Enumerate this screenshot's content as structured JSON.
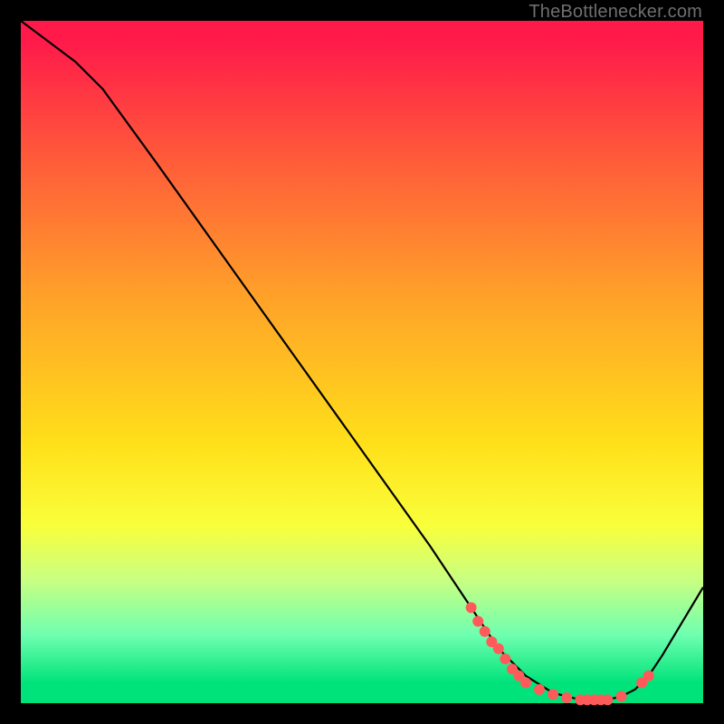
{
  "attribution": "TheBottlenecker.com",
  "chart_data": {
    "type": "line",
    "title": "",
    "xlabel": "",
    "ylabel": "",
    "xlim": [
      0,
      100
    ],
    "ylim": [
      0,
      100
    ],
    "series": [
      {
        "name": "curve",
        "x": [
          0,
          4,
          8,
          12,
          20,
          30,
          40,
          50,
          60,
          66,
          70,
          74,
          78,
          82,
          86,
          88,
          90,
          92,
          94,
          100
        ],
        "y": [
          100,
          97,
          94,
          90,
          79,
          65,
          51,
          37,
          23,
          14,
          8,
          4,
          1.5,
          0.5,
          0.5,
          1,
          2,
          4,
          7,
          17
        ]
      }
    ],
    "markers": [
      {
        "x": 66,
        "y": 14
      },
      {
        "x": 67,
        "y": 12
      },
      {
        "x": 68,
        "y": 10.5
      },
      {
        "x": 69,
        "y": 9
      },
      {
        "x": 70,
        "y": 8
      },
      {
        "x": 71,
        "y": 6.5
      },
      {
        "x": 72,
        "y": 5
      },
      {
        "x": 73,
        "y": 4
      },
      {
        "x": 74,
        "y": 3
      },
      {
        "x": 76,
        "y": 2
      },
      {
        "x": 78,
        "y": 1.3
      },
      {
        "x": 80,
        "y": 0.8
      },
      {
        "x": 82,
        "y": 0.5
      },
      {
        "x": 83,
        "y": 0.5
      },
      {
        "x": 84,
        "y": 0.5
      },
      {
        "x": 85,
        "y": 0.5
      },
      {
        "x": 86,
        "y": 0.5
      },
      {
        "x": 88,
        "y": 1
      },
      {
        "x": 91,
        "y": 3
      },
      {
        "x": 92,
        "y": 4
      }
    ],
    "colors": {
      "curve": "#000000",
      "marker": "#ff5a5a"
    }
  }
}
